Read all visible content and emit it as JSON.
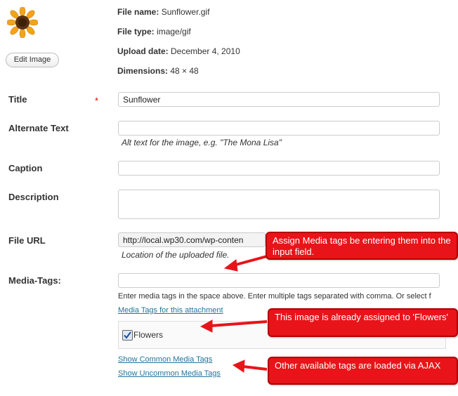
{
  "file": {
    "name_label": "File name:",
    "name": "Sunflower.gif",
    "type_label": "File type:",
    "type": "image/gif",
    "upload_label": "Upload date:",
    "upload": "December 4, 2010",
    "dim_label": "Dimensions:",
    "dim": "48 × 48"
  },
  "edit_button": "Edit Image",
  "fields": {
    "title_label": "Title",
    "required_mark": "*",
    "title_value": "Sunflower",
    "alt_label": "Alternate Text",
    "alt_hint": "Alt text for the image, e.g. \"The Mona Lisa\"",
    "caption_label": "Caption",
    "description_label": "Description",
    "fileurl_label": "File URL",
    "fileurl_value": "http://local.wp30.com/wp-conten",
    "fileurl_hint": "Location of the uploaded file.",
    "mediatags_label": "Media-Tags:",
    "mediatags_help": "Enter media tags in the space above. Enter multiple tags separated with comma. Or select f"
  },
  "links": {
    "attachment_tags": "Media Tags for this attachment",
    "common": "Show Common Media Tags",
    "uncommon": "Show Uncommon Media Tags"
  },
  "tag_item": "Flowers",
  "callouts": {
    "assign": "Assign Media tags be entering them into the input field.",
    "already": "This image is already assigned to 'Flowers'",
    "other": "Other available tags are loaded via AJAX"
  },
  "colors": {
    "callout": "#e8141a",
    "link": "#21759b",
    "required": "#dd0000"
  }
}
